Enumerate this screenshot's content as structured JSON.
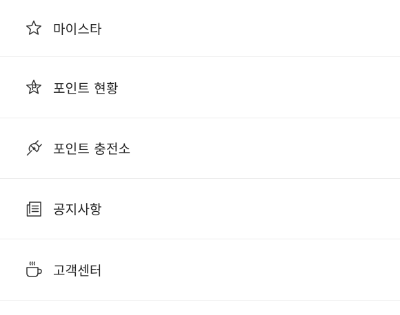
{
  "menu": {
    "items": [
      {
        "label": "마이스타",
        "icon": "star-icon"
      },
      {
        "label": "포인트 현황",
        "icon": "point-star-icon"
      },
      {
        "label": "포인트 충전소",
        "icon": "charging-plug-icon"
      },
      {
        "label": "공지사항",
        "icon": "notice-document-icon"
      },
      {
        "label": "고객센터",
        "icon": "coffee-cup-icon"
      }
    ]
  },
  "colors": {
    "text": "#222222",
    "icon_stroke": "#333333",
    "divider": "#ececec",
    "background": "#ffffff"
  }
}
